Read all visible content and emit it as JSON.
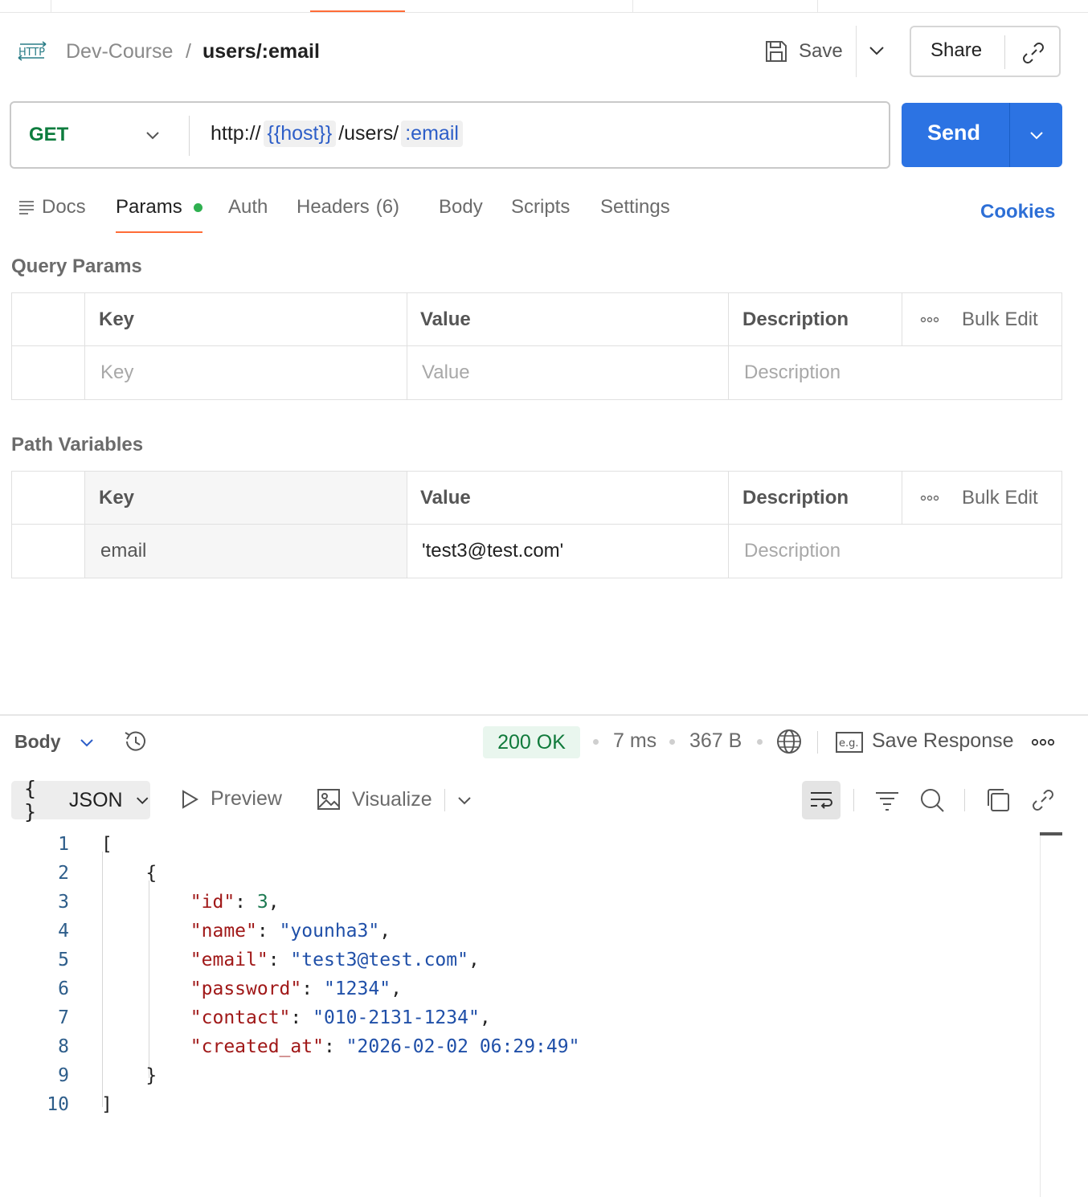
{
  "breadcrumb": {
    "icon": "http-icon",
    "collection": "Dev-Course",
    "separator": "/",
    "request": "users/:email"
  },
  "toolbar": {
    "save_label": "Save",
    "share_label": "Share"
  },
  "request": {
    "method": "GET",
    "url_parts": [
      {
        "text": "http://",
        "var": false
      },
      {
        "text": "{{host}}",
        "var": true
      },
      {
        "text": "/users/",
        "var": false
      },
      {
        "text": ":email",
        "var": true
      }
    ],
    "send_label": "Send"
  },
  "tabs": {
    "docs": "Docs",
    "params": "Params",
    "auth": "Auth",
    "headers": "Headers",
    "headers_count": "(6)",
    "body": "Body",
    "scripts": "Scripts",
    "settings": "Settings",
    "active": "Params",
    "cookies": "Cookies"
  },
  "query_params": {
    "title": "Query Params",
    "headers": {
      "key": "Key",
      "value": "Value",
      "description": "Description",
      "bulk_edit": "Bulk Edit"
    },
    "row_placeholders": {
      "key": "Key",
      "value": "Value",
      "description": "Description"
    }
  },
  "path_variables": {
    "title": "Path Variables",
    "headers": {
      "key": "Key",
      "value": "Value",
      "description": "Description",
      "bulk_edit": "Bulk Edit"
    },
    "row": {
      "key": "email",
      "value": "'test3@test.com'",
      "description_placeholder": "Description"
    }
  },
  "response": {
    "body_label": "Body",
    "status": "200 OK",
    "time": "7 ms",
    "size": "367 B",
    "save_response": "Save Response",
    "format": "JSON",
    "format_icon": "{ }",
    "preview": "Preview",
    "visualize": "Visualize",
    "lines": [
      {
        "n": "1",
        "tokens": [
          {
            "t": "[",
            "c": "p"
          }
        ]
      },
      {
        "n": "2",
        "tokens": [
          {
            "t": "    {",
            "c": "p"
          }
        ]
      },
      {
        "n": "3",
        "tokens": [
          {
            "t": "        ",
            "c": "p"
          },
          {
            "t": "\"id\"",
            "c": "k"
          },
          {
            "t": ": ",
            "c": "p"
          },
          {
            "t": "3",
            "c": "n"
          },
          {
            "t": ",",
            "c": "p"
          }
        ]
      },
      {
        "n": "4",
        "tokens": [
          {
            "t": "        ",
            "c": "p"
          },
          {
            "t": "\"name\"",
            "c": "k"
          },
          {
            "t": ": ",
            "c": "p"
          },
          {
            "t": "\"younha3\"",
            "c": "s"
          },
          {
            "t": ",",
            "c": "p"
          }
        ]
      },
      {
        "n": "5",
        "tokens": [
          {
            "t": "        ",
            "c": "p"
          },
          {
            "t": "\"email\"",
            "c": "k"
          },
          {
            "t": ": ",
            "c": "p"
          },
          {
            "t": "\"test3@test.com\"",
            "c": "s"
          },
          {
            "t": ",",
            "c": "p"
          }
        ]
      },
      {
        "n": "6",
        "tokens": [
          {
            "t": "        ",
            "c": "p"
          },
          {
            "t": "\"password\"",
            "c": "k"
          },
          {
            "t": ": ",
            "c": "p"
          },
          {
            "t": "\"1234\"",
            "c": "s"
          },
          {
            "t": ",",
            "c": "p"
          }
        ]
      },
      {
        "n": "7",
        "tokens": [
          {
            "t": "        ",
            "c": "p"
          },
          {
            "t": "\"contact\"",
            "c": "k"
          },
          {
            "t": ": ",
            "c": "p"
          },
          {
            "t": "\"010-2131-1234\"",
            "c": "s"
          },
          {
            "t": ",",
            "c": "p"
          }
        ]
      },
      {
        "n": "8",
        "tokens": [
          {
            "t": "        ",
            "c": "p"
          },
          {
            "t": "\"created_at\"",
            "c": "k"
          },
          {
            "t": ": ",
            "c": "p"
          },
          {
            "t": "\"2026-02-02 06:29:49\"",
            "c": "s"
          }
        ]
      },
      {
        "n": "9",
        "tokens": [
          {
            "t": "    }",
            "c": "p"
          }
        ]
      },
      {
        "n": "10",
        "tokens": [
          {
            "t": "]",
            "c": "p"
          }
        ]
      }
    ]
  },
  "colors": {
    "accent": "#ff6c37",
    "send": "#2c73e3",
    "method_get": "#0d7c3e",
    "status_ok": "#107a3b",
    "json_key": "#a01818",
    "json_string": "#1f4fa8",
    "json_number": "#1d7a52"
  }
}
